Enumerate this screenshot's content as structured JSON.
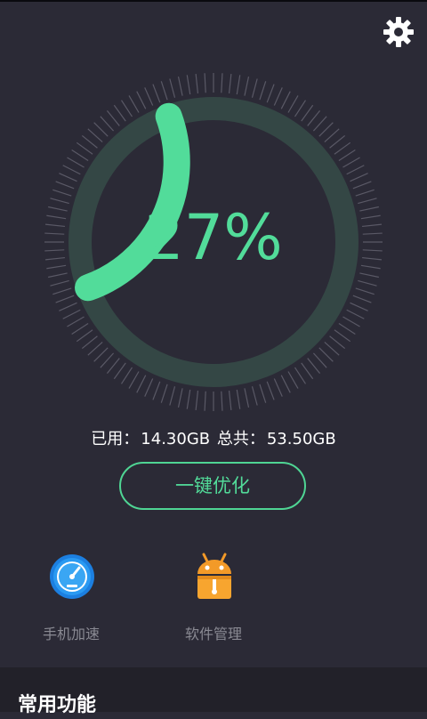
{
  "memory": {
    "percent": 27,
    "percent_label": "27%",
    "used_label": "已用：",
    "used_value": "14.30GB",
    "total_label": "总共：",
    "total_value": "53.50GB"
  },
  "actions": {
    "optimize_label": "一键优化"
  },
  "tools": [
    {
      "label": "手机加速",
      "icon": "speedometer-icon"
    },
    {
      "label": "软件管理",
      "icon": "android-package-icon"
    }
  ],
  "section": {
    "title": "常用功能"
  },
  "colors": {
    "accent": "#52dc9a",
    "background": "#2b2a36",
    "panel": "#222129",
    "muted_text": "#8a8a93"
  }
}
